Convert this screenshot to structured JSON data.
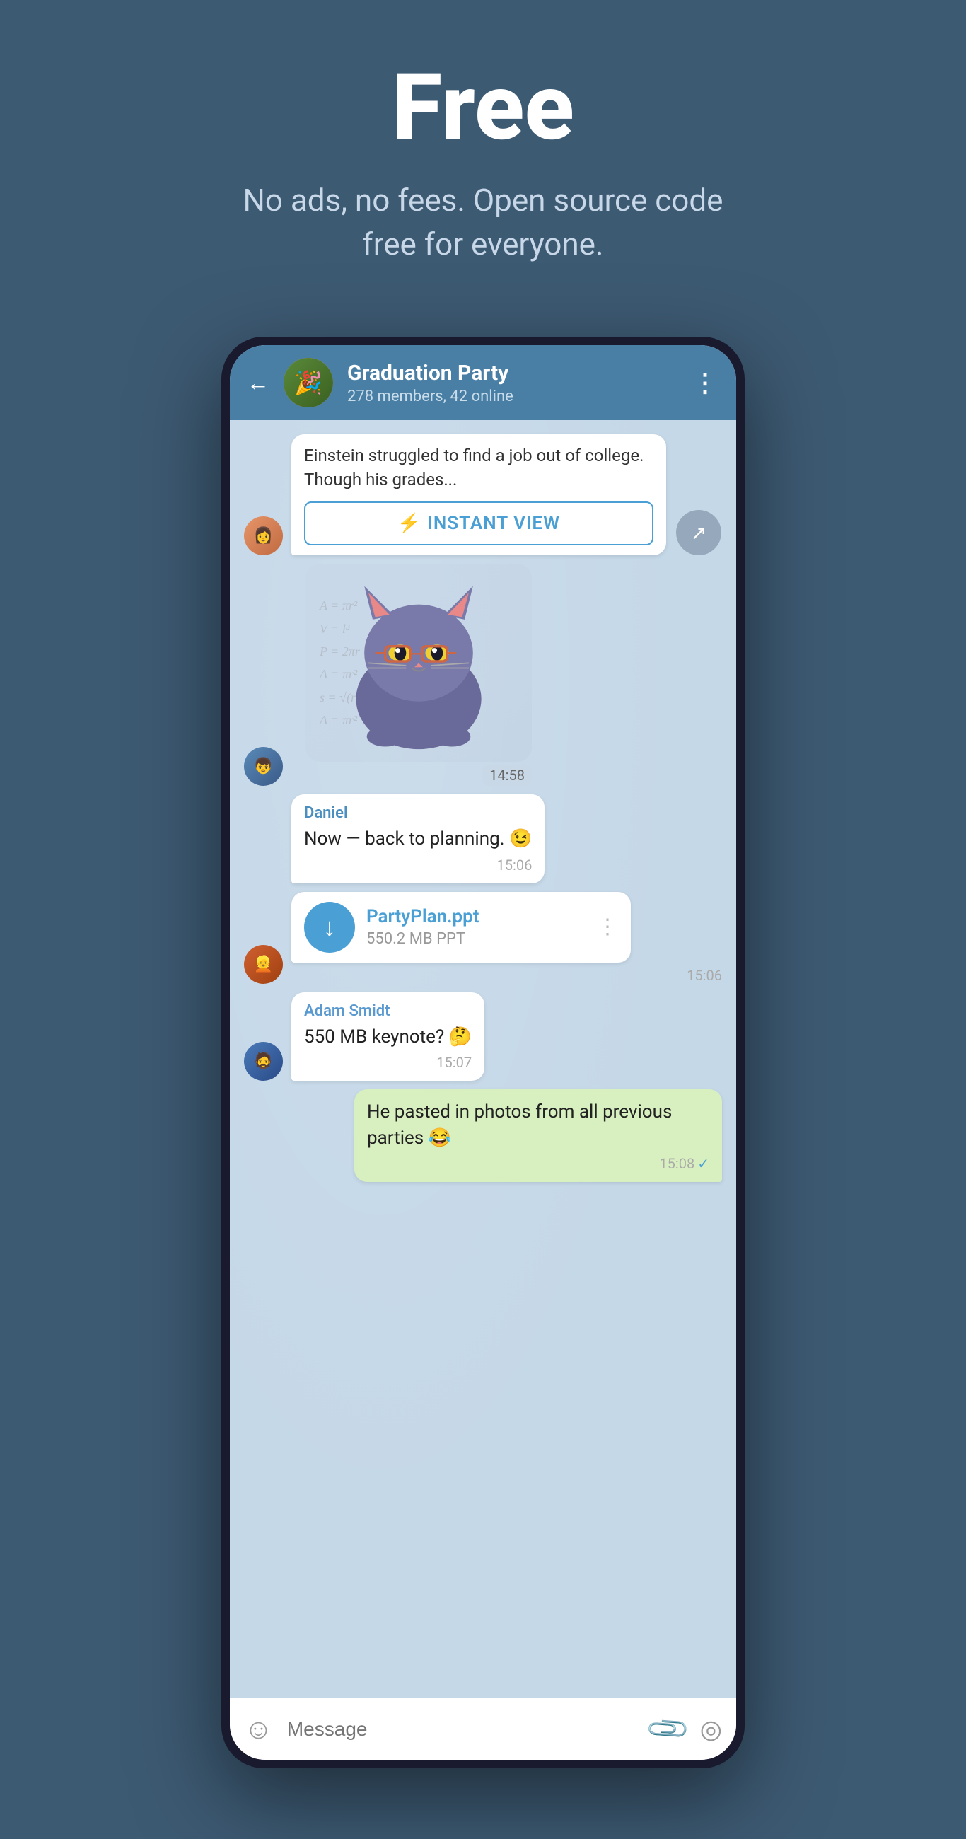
{
  "hero": {
    "title": "Free",
    "subtitle": "No ads, no fees. Open source code free for everyone."
  },
  "phone": {
    "header": {
      "back_label": "←",
      "group_name": "Graduation Party",
      "group_members": "278 members, 42 online",
      "menu_icon": "⋮"
    },
    "messages": [
      {
        "id": "link-preview",
        "type": "link",
        "avatar": "female",
        "text": "Einstein struggled to find a job out of college. Though his grades...",
        "instant_view_label": "INSTANT VIEW",
        "has_share": true
      },
      {
        "id": "sticker-msg",
        "type": "sticker",
        "avatar": "male1",
        "time": "14:58"
      },
      {
        "id": "daniel-msg",
        "type": "text",
        "sender": "Daniel",
        "text": "Now — back to planning. 😉",
        "time": "15:06",
        "bubble": "white",
        "avatar": null
      },
      {
        "id": "file-msg",
        "type": "file",
        "avatar": "male2",
        "file_name": "PartyPlan.ppt",
        "file_size": "550.2 MB PPT",
        "time": "15:06"
      },
      {
        "id": "adam-msg",
        "type": "text",
        "sender": "Adam Smidt",
        "text": "550 MB keynote? 🤔",
        "time": "15:07",
        "bubble": "white",
        "avatar": "male3"
      },
      {
        "id": "my-msg",
        "type": "text",
        "text": "He pasted in photos from all previous parties 😂",
        "time": "15:08",
        "bubble": "green",
        "check": true,
        "avatar": null
      }
    ],
    "input": {
      "placeholder": "Message",
      "emoji_icon": "☺",
      "attach_icon": "📎",
      "camera_icon": "⊙"
    }
  }
}
